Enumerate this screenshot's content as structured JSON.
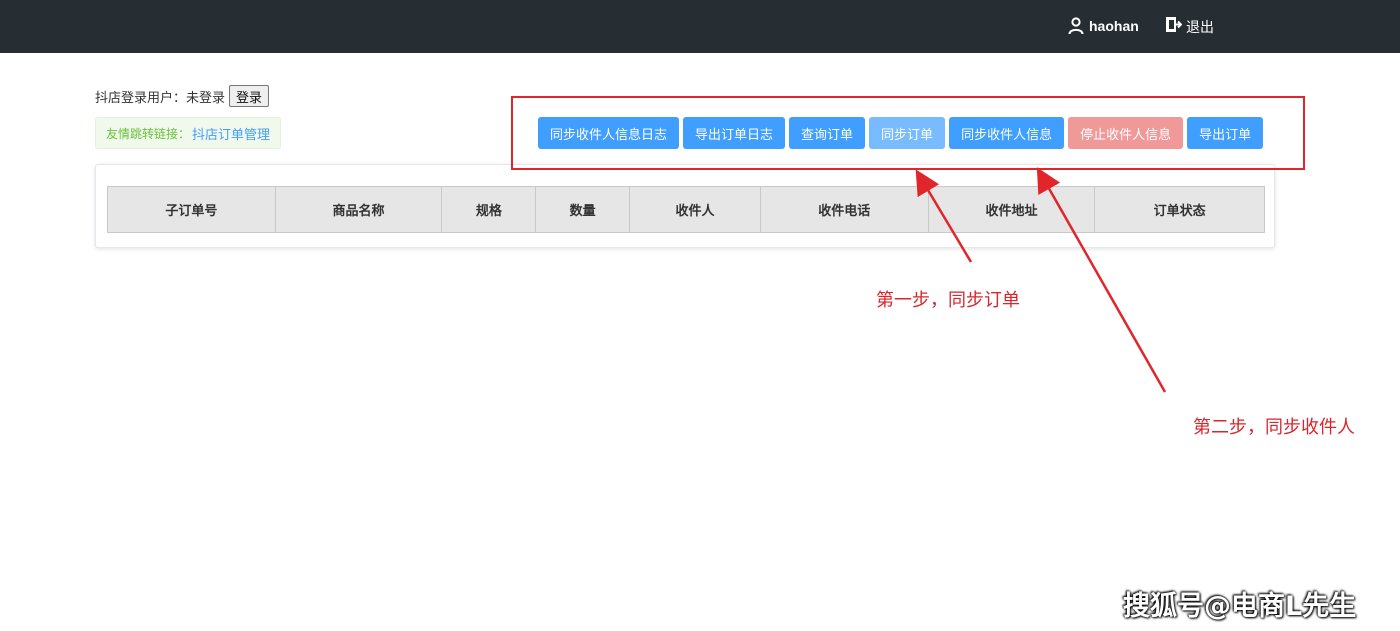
{
  "header": {
    "username": "haohan",
    "logout_label": "退出",
    "user_icon": "user-icon",
    "logout_icon": "logout-icon"
  },
  "login": {
    "prefix": "抖店登录用户：",
    "status": "未登录",
    "button_label": "登录"
  },
  "friend_link": {
    "label": "友情跳转链接：",
    "link_text": "抖店订单管理"
  },
  "actions": [
    {
      "label": "同步收件人信息日志"
    },
    {
      "label": "导出订单日志"
    },
    {
      "label": "查询订单"
    },
    {
      "label": "同步订单"
    },
    {
      "label": "同步收件人信息"
    },
    {
      "label": "停止收件人信息"
    },
    {
      "label": "导出订单"
    }
  ],
  "table": {
    "columns": [
      "子订单号",
      "商品名称",
      "规格",
      "数量",
      "收件人",
      "收件电话",
      "收件地址",
      "订单状态"
    ]
  },
  "annotations": {
    "step1": "第一步，同步订单",
    "step2": "第二步，同步收件人"
  },
  "watermark": "搜狐号@电商L先生",
  "colors": {
    "topbar": "#262d33",
    "primary": "#409eff",
    "primary_light": "#79bbff",
    "danger_light": "#f09999",
    "annotation_red": "#e0262b"
  }
}
